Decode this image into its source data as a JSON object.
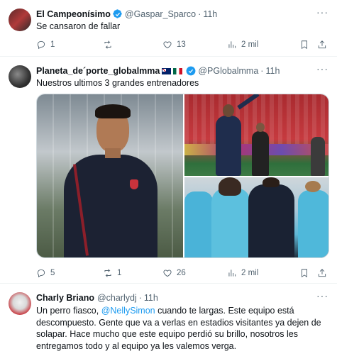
{
  "tweets": [
    {
      "name": "El Campeonísimo",
      "handle": "@Gaspar_Sparco",
      "separator": "·",
      "time": "11h",
      "text": "Se cansaron de fallar",
      "stats": {
        "replies": "1",
        "retweets": "",
        "likes": "13",
        "views": "2 mil"
      }
    },
    {
      "name": "Planeta_de´porte_globalmma",
      "handle": "@PGlobalmma",
      "separator": "·",
      "time": "11h",
      "text": "Nuestros ultimos 3 grandes entrenadores",
      "stats": {
        "replies": "5",
        "retweets": "1",
        "likes": "26",
        "views": "2 mil"
      }
    },
    {
      "name": "Charly Briano",
      "handle": "@charlydj",
      "separator": "·",
      "time": "11h",
      "text_before": "Un perro fiasco, ",
      "mention": "@NellySimon",
      "text_after": " cuando te largas. Este equipo está descompuesto. Gente que va a verlas en estadios visitantes ya dejen de solapar. Hace mucho que este equipo perdió su brillo, nosotros les entregamos todo y al equipo ya les valemos verga."
    }
  ],
  "more_label": "···",
  "colors": {
    "verified": "#1d9bf0",
    "text": "#0f1419",
    "muted": "#536471",
    "link": "#1d9bf0",
    "divider": "#eff3f4"
  },
  "icons": [
    "verified-badge-icon",
    "reply-icon",
    "retweet-icon",
    "like-icon",
    "views-icon",
    "bookmark-icon",
    "share-icon",
    "more-icon"
  ]
}
